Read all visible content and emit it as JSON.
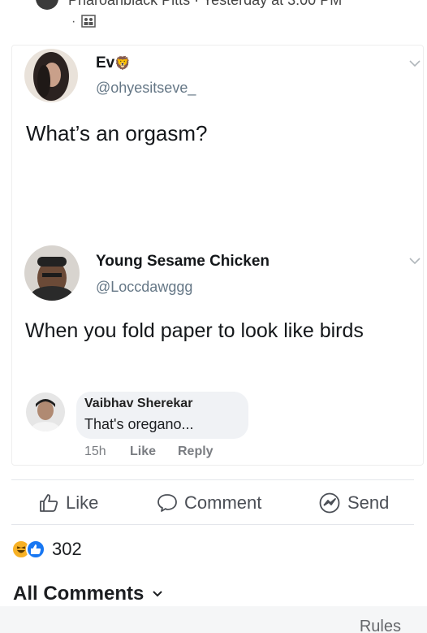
{
  "post_header": {
    "author_partial": "Pharoahblack Pitts · Yesterday at 3:00 PM",
    "dot": "·",
    "privacy_icon": "friends-icon"
  },
  "tweets": [
    {
      "name": "Ev",
      "name_emoji": "🦁",
      "handle": "@ohyesitseve_",
      "text": "What’s an orgasm?"
    },
    {
      "name": "Young Sesame Chicken",
      "handle": "@Loccdawggg",
      "text": "When you fold paper to look like birds"
    }
  ],
  "comment": {
    "author": "Vaibhav Sherekar",
    "text": "That's oregano...",
    "time": "15h",
    "like_label": "Like",
    "reply_label": "Reply"
  },
  "actions": {
    "like": "Like",
    "comment": "Comment",
    "send": "Send"
  },
  "reactions": {
    "count": "302",
    "types": [
      "haha",
      "like"
    ]
  },
  "comments_filter": {
    "label": "All Comments"
  },
  "footer": {
    "rules": "Rules"
  },
  "colors": {
    "like_blue": "#1877f2",
    "haha_yellow": "#f7b125",
    "muted_text": "#65676b",
    "handle_gray": "#657786"
  }
}
